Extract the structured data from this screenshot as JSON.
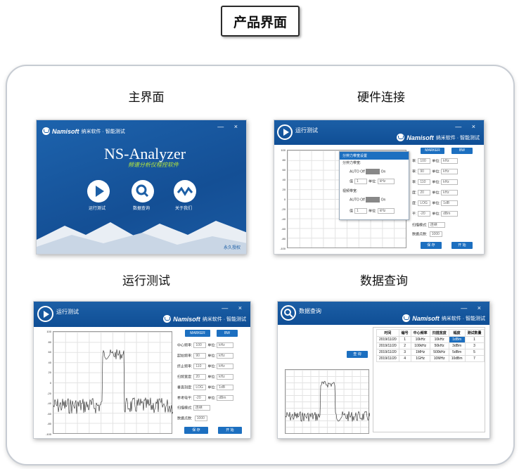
{
  "header": {
    "title": "产品界面"
  },
  "sections": {
    "main": "主界面",
    "hardware": "硬件连接",
    "run": "运行测试",
    "query": "数据查询"
  },
  "brand": {
    "name": "Namisoft",
    "text": "纳米软件 · 智能测试"
  },
  "main_ui": {
    "app_name": "NS-Analyzer",
    "subtitle": "频谱分析仪程控软件",
    "buttons": [
      "运行测试",
      "数据查询",
      "关于我们"
    ],
    "footer": "永久授权",
    "winctl": "— ×"
  },
  "run_ui": {
    "title": "运行测试",
    "marker": "MARKER",
    "bw": "BW",
    "fields": [
      {
        "label": "中心频率:",
        "value": "100",
        "unit": "单位:",
        "sel": "kHz"
      },
      {
        "label": "起始频率:",
        "value": "90",
        "unit": "单位:",
        "sel": "kHz"
      },
      {
        "label": "终止频率:",
        "value": "110",
        "unit": "单位:",
        "sel": "kHz"
      },
      {
        "label": "扫频宽度:",
        "value": "20",
        "unit": "单位:",
        "sel": "kHz"
      },
      {
        "label": "垂直刻度:",
        "value": "LOG",
        "unit": "单位:",
        "sel": "1dB"
      },
      {
        "label": "参考电平:",
        "value": "-20",
        "unit": "单位:",
        "sel": "dBm"
      }
    ],
    "scan_mode_label": "扫描模式:",
    "scan_mode": "连续",
    "count_label": "数据点数:",
    "count": "1000",
    "save": "保 存",
    "start": "开 始",
    "ylabels": [
      "100",
      "80",
      "60",
      "40",
      "20",
      "0",
      "-20",
      "-40",
      "-60",
      "-80",
      "-100"
    ],
    "hw_ylabels": [
      "100",
      "80",
      "60",
      "40",
      "20",
      "0",
      "-20",
      "-40",
      "-60",
      "-80",
      "-100"
    ]
  },
  "hw_ui": {
    "dialog_title": "分辨力带宽设置",
    "rbw_label": "分辨力带宽:",
    "vbw_label": "视频带宽:",
    "auto": "AUTO",
    "on": "On",
    "off": "Off",
    "value_label": "值",
    "value": "1",
    "unit": "单位:",
    "unit_sel": "kHz",
    "fields": [
      {
        "label": "率:",
        "value": "100",
        "unit": "单位:",
        "sel": "kHz"
      },
      {
        "label": "率:",
        "value": "90",
        "unit": "单位:",
        "sel": "kHz"
      },
      {
        "label": "率:",
        "value": "110",
        "unit": "单位:",
        "sel": "kHz"
      },
      {
        "label": "度:",
        "value": "20",
        "unit": "单位:",
        "sel": "kHz"
      },
      {
        "label": "度:",
        "value": "LOG",
        "unit": "单位:",
        "sel": "1dB"
      },
      {
        "label": "平:",
        "value": "-20",
        "unit": "单位:",
        "sel": "dBm"
      }
    ]
  },
  "query_ui": {
    "title": "数据查询",
    "query_button": "查 询",
    "columns": [
      "时间",
      "编号",
      "中心频率",
      "扫描宽度",
      "幅度",
      "测试数量"
    ],
    "rows": [
      [
        "2019/11/20",
        "1",
        "10kHz",
        "10kHz",
        "1dBm",
        "1"
      ],
      [
        "2019/11/20",
        "2",
        "100kHz",
        "50kHz",
        "3dBm",
        "3"
      ],
      [
        "2019/11/20",
        "3",
        "1MHz",
        "500kHz",
        "5dBm",
        "5"
      ],
      [
        "2019/11/20",
        "4",
        "1GHz",
        "10MHz",
        "10dBm",
        "7"
      ]
    ]
  },
  "colors": {
    "brand_blue": "#1c5fa6",
    "button_blue": "#1c6fc0",
    "lime": "#b9e93a"
  }
}
